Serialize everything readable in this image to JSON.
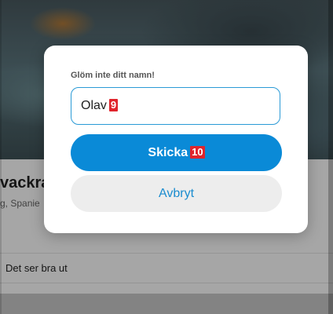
{
  "background": {
    "place_title": "vackra",
    "place_subtitle": "g, Spanie",
    "comment": "Det ser bra ut"
  },
  "modal": {
    "label": "Glöm inte ditt namn!",
    "name_input": {
      "value": "Olav",
      "marker": "9"
    },
    "submit_button": {
      "label": "Skicka",
      "marker": "10"
    },
    "cancel_button": {
      "label": "Avbryt"
    }
  },
  "colors": {
    "accent": "#0a8ad7",
    "input_border": "#2a9ad6",
    "marker": "#e0242c",
    "cancel_bg": "#ededed"
  }
}
